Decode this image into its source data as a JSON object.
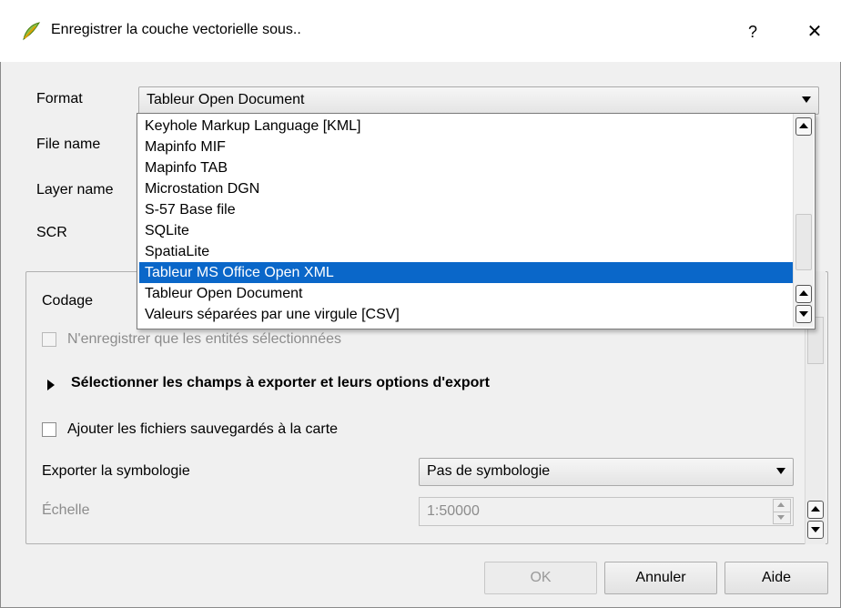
{
  "window": {
    "title": "Enregistrer la couche vectorielle sous..",
    "help_label": "?",
    "close_label": "✕"
  },
  "form": {
    "format_label": "Format",
    "format_value": "Tableur Open Document",
    "filename_label": "File name",
    "layername_label": "Layer name",
    "scr_label": "SCR"
  },
  "dropdown": {
    "items": [
      "Keyhole Markup Language [KML]",
      "Mapinfo MIF",
      "Mapinfo TAB",
      "Microstation DGN",
      "S-57 Base file",
      "SQLite",
      "SpatiaLite",
      "Tableur MS Office Open XML",
      "Tableur Open Document",
      "Valeurs séparées par une virgule [CSV]"
    ],
    "selected_index": 7
  },
  "group": {
    "codage_label": "Codage",
    "selected_only_label": "N'enregistrer que les entités sélectionnées",
    "fields_section_label": "Sélectionner les champs à exporter et leurs options d'export",
    "add_to_map_label": "Ajouter les fichiers sauvegardés à la carte",
    "symbology_label": "Exporter la symbologie",
    "symbology_value": "Pas de symbologie",
    "scale_label": "Échelle",
    "scale_value": "1:50000"
  },
  "buttons": {
    "ok": "OK",
    "cancel": "Annuler",
    "help": "Aide"
  },
  "colors": {
    "selection": "#0a67c9",
    "app_icon": "#7ab51d"
  }
}
